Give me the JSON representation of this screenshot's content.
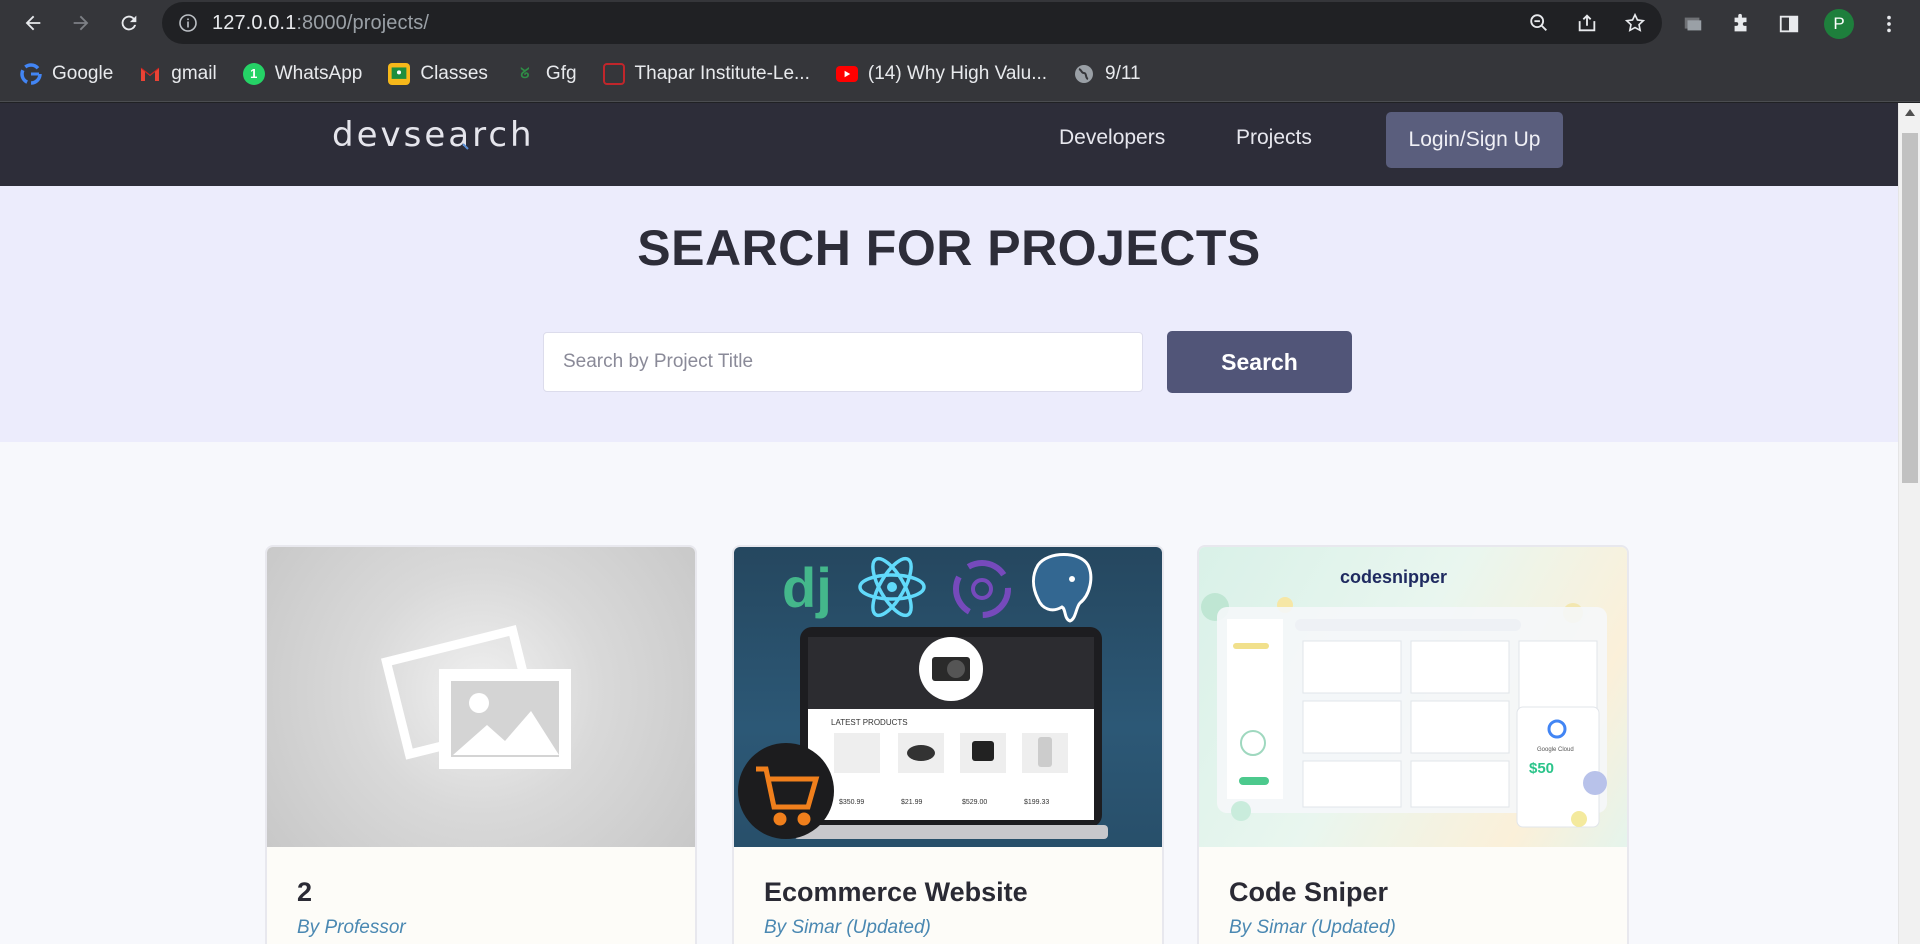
{
  "browser": {
    "url_host": "127.0.0.1",
    "url_rest": ":8000/projects/",
    "profile_initial": "P",
    "bookmarks": [
      {
        "label": "Google",
        "icon": "google-icon"
      },
      {
        "label": "gmail",
        "icon": "gmail-icon"
      },
      {
        "label": "WhatsApp",
        "icon": "whatsapp-icon"
      },
      {
        "label": "Classes",
        "icon": "classroom-icon"
      },
      {
        "label": "Gfg",
        "icon": "gfg-icon"
      },
      {
        "label": "Thapar Institute-Le...",
        "icon": "thapar-icon"
      },
      {
        "label": "(14) Why High Valu...",
        "icon": "youtube-icon"
      },
      {
        "label": "9/11",
        "icon": "globe-icon"
      }
    ]
  },
  "site": {
    "logo_pre": "devse",
    "logo_lens": "a",
    "logo_post": "rch",
    "nav": {
      "developers": "Developers",
      "projects": "Projects",
      "login": "Login/Sign Up"
    }
  },
  "hero": {
    "title_light": "SEARCH FOR ",
    "title_bold": "PROJECTS",
    "search_placeholder": "Search by Project Title",
    "search_button": "Search"
  },
  "projects": [
    {
      "title": "2",
      "author": "By Professor"
    },
    {
      "title": "Ecommerce Website",
      "author": "By Simar (Updated)"
    },
    {
      "title": "Code Sniper",
      "author": "By Simar (Updated)",
      "thumb_heading": "codesnipper",
      "thumb_badge": "$50",
      "thumb_cloud": "Google Cloud"
    }
  ],
  "thumb_texts": {
    "latest_products": "LATEST PRODUCTS",
    "prices": [
      "$350.99",
      "$21.99",
      "$529.00",
      "$199.33"
    ],
    "logos": [
      "dj"
    ]
  },
  "colors": {
    "header_bg": "#2d2d39",
    "hero_bg": "#ececfc",
    "button_bg": "#515578",
    "author_color": "#4a88b2"
  }
}
